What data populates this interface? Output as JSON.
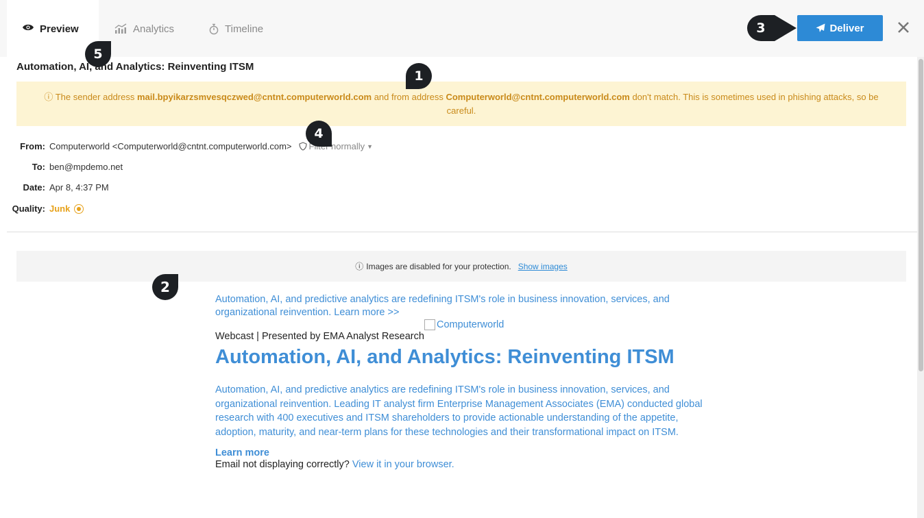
{
  "tabs": [
    {
      "label": "Preview",
      "icon": "eye-icon",
      "active": true
    },
    {
      "label": "Analytics",
      "icon": "analytics-icon",
      "active": false
    },
    {
      "label": "Timeline",
      "icon": "stopwatch-icon",
      "active": false
    }
  ],
  "actions": {
    "deliver_label": "Deliver",
    "deliver_icon": "paper-plane-icon",
    "close_icon": "close-icon"
  },
  "subject": "Automation, AI, and Analytics: Reinventing ITSM",
  "warning": {
    "pre": "The sender address ",
    "sender": "mail.bpyikarzsmvesqczwed@cntnt.computerworld.com",
    "mid": " and from address ",
    "from": "Computerworld@cntnt.computerworld.com",
    "post": " don't match. This is sometimes used in phishing attacks, so be careful."
  },
  "meta": {
    "from_label": "From:",
    "from_value": "Computerworld <Computerworld@cntnt.computerworld.com>",
    "filter_label": "Filter normally",
    "to_label": "To:",
    "to_value": "ben@mpdemo.net",
    "date_label": "Date:",
    "date_value": "Apr 8, 4:37 PM",
    "quality_label": "Quality:",
    "quality_value": "Junk"
  },
  "images_bar": {
    "text": "Images are disabled for your protection.",
    "link": "Show images"
  },
  "email": {
    "intro": "Automation, AI, and predictive analytics are redefining ITSM's role in business innovation, services, and organizational reinvention. Learn more >>",
    "logo_alt": "Computerworld",
    "webcast": "Webcast | Presented by EMA Analyst Research",
    "headline": "Automation, AI, and Analytics: Reinventing ITSM",
    "body": "Automation, AI, and predictive analytics are redefining ITSM's role in business innovation, services, and organizational reinvention. Leading IT analyst firm Enterprise Management Associates (EMA) conducted global research with 400 executives and ITSM shareholders to provide actionable understanding of the appetite, adoption, maturity, and near-term plans for these technologies and their transformational impact on ITSM.",
    "learn_more": "Learn more",
    "not_displaying": "Email not displaying correctly? ",
    "view_browser": "View it in your browser."
  },
  "markers": [
    "1",
    "2",
    "3",
    "4",
    "5"
  ],
  "colors": {
    "accent": "#2d8ad6",
    "warning_bg": "#fdf4d3",
    "warning_text": "#c98a1a",
    "junk": "#e7a21c",
    "marker": "#1d2024"
  }
}
